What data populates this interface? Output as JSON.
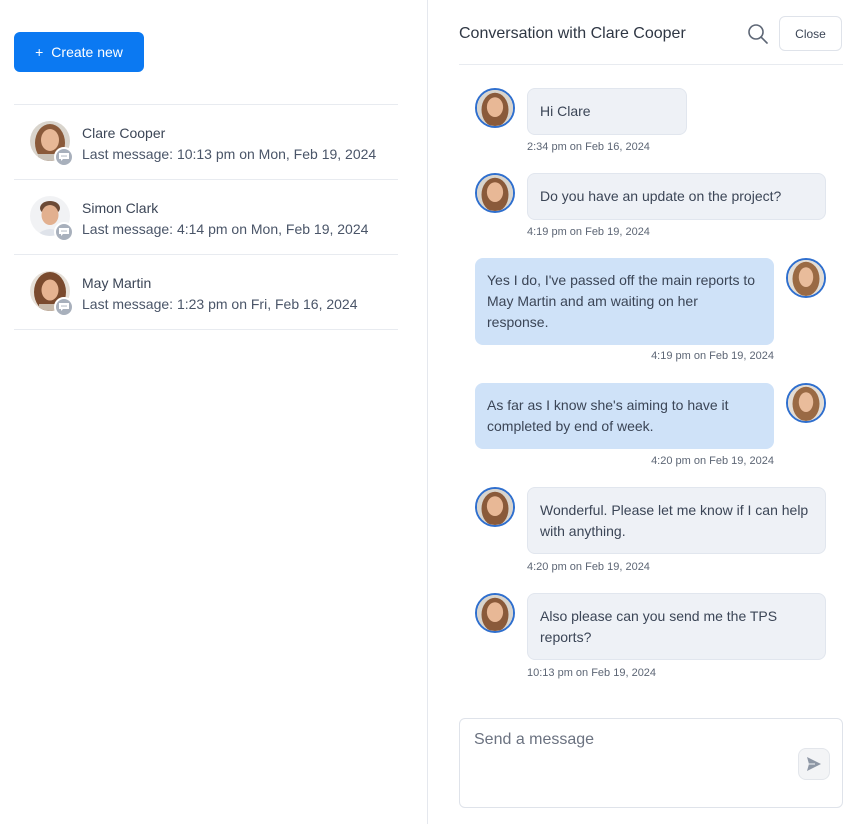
{
  "sidebar": {
    "create_label": "Create new",
    "items": [
      {
        "name": "Clare Cooper",
        "last": "Last message: 10:13 pm on Mon, Feb 19, 2024"
      },
      {
        "name": "Simon Clark",
        "last": "Last message: 4:14 pm on Mon, Feb 19, 2024"
      },
      {
        "name": "May Martin",
        "last": "Last message: 1:23 pm on Fri, Feb 16, 2024"
      }
    ]
  },
  "header": {
    "title": "Conversation with Clare Cooper",
    "close_label": "Close"
  },
  "messages": [
    {
      "direction": "in",
      "text": "Hi Clare",
      "time": "2:34 pm on Feb 16, 2024"
    },
    {
      "direction": "in",
      "text": "Do you have an update on the project?",
      "time": "4:19 pm on Feb 19, 2024"
    },
    {
      "direction": "out",
      "text": "Yes I do, I've passed off the main reports to May Martin and am waiting on her response.",
      "time": "4:19 pm on Feb 19, 2024"
    },
    {
      "direction": "out",
      "text": "As far as I know she's aiming to have it completed by end of week.",
      "time": "4:20 pm on Feb 19, 2024"
    },
    {
      "direction": "in",
      "text": "Wonderful. Please let me know if I can help with anything.",
      "time": "4:20 pm on Feb 19, 2024"
    },
    {
      "direction": "in",
      "text": "Also please can you send me the TPS reports?",
      "time": "10:13 pm on Feb 19, 2024"
    }
  ],
  "composer": {
    "placeholder": "Send a message"
  },
  "icons": {
    "search": "search-icon",
    "send": "send-icon",
    "chat_badge": "chat-bubble-icon",
    "plus": "plus-icon"
  },
  "colors": {
    "primary": "#0b79f2",
    "outgoing_bubble": "#cfe2f8",
    "incoming_bubble": "#eef1f6"
  }
}
